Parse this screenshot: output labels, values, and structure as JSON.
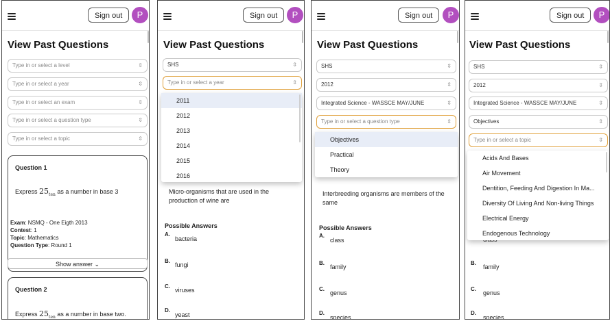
{
  "header": {
    "sign_out_label": "Sign out",
    "avatar_initial": "P"
  },
  "page_title": "View Past Questions",
  "placeholders": {
    "level": "Type in or select a level",
    "year": "Type in or select a year",
    "exam": "Type in or select an exam",
    "question_type": "Type in or select a question type",
    "topic": "Type in or select a topic"
  },
  "panel1": {
    "question1": {
      "title": "Question 1",
      "text_prefix": "Express",
      "num": "25",
      "sub": "ten",
      "text_suffix": "as a number in base 3",
      "exam_label": "Exam",
      "exam_value": ": NSMQ - One Eigth 2013",
      "contest_label": "Contest",
      "contest_value": ": 1",
      "topic_label": "Topic",
      "topic_value": ": Mathematics",
      "qtype_label": "Question Type",
      "qtype_value": ": Round 1",
      "show_answer": "Show answer",
      "chevron": "⌄"
    },
    "question2": {
      "title": "Question 2",
      "text_prefix": "Express",
      "num": "25",
      "sub": "ten",
      "text_suffix": "as a number in base two."
    }
  },
  "panel2": {
    "level_value": "SHS",
    "year_options": [
      "2011",
      "2012",
      "2013",
      "2014",
      "2015",
      "2016"
    ],
    "question_text": "Micro-organisms that are used in the production of wine are",
    "possible_answers_label": "Possible Answers",
    "answers": [
      {
        "letter": "A.",
        "text": "bacteria"
      },
      {
        "letter": "B.",
        "text": "fungi"
      },
      {
        "letter": "C.",
        "text": "viruses"
      },
      {
        "letter": "D.",
        "text": "yeast"
      }
    ]
  },
  "panel3": {
    "level_value": "SHS",
    "year_value": "2012",
    "exam_value": "Integrated Science - WASSCE MAY/JUNE",
    "qtype_options": [
      "Objectives",
      "Practical",
      "Theory"
    ],
    "question_text": "Interbreeding organisms are members of the same",
    "possible_answers_label": "Possible Answers",
    "answers": [
      {
        "letter": "A.",
        "text": "class"
      },
      {
        "letter": "B.",
        "text": "family"
      },
      {
        "letter": "C.",
        "text": "genus"
      },
      {
        "letter": "D.",
        "text": "species"
      }
    ]
  },
  "panel4": {
    "level_value": "SHS",
    "year_value": "2012",
    "exam_value": "Integrated Science - WASSCE MAY/JUNE",
    "qtype_value": "Objectives",
    "topic_options": [
      "Acids And Bases",
      "Air Movement",
      "Dentition, Feeding And Digestion In Ma...",
      "Diversity Of Living And Non-living Things",
      "Electrical Energy",
      "Endogenous Technology"
    ],
    "peek_text": "class",
    "answers": [
      {
        "letter": "B.",
        "text": "family"
      },
      {
        "letter": "C.",
        "text": "genus"
      },
      {
        "letter": "D.",
        "text": "species"
      }
    ]
  },
  "icons": {
    "updown": "⇳",
    "hamburger": "menu-icon"
  },
  "colors": {
    "avatar": "#b24fbf",
    "focus_border": "#e0a03a",
    "selected_option": "#e8edf7"
  }
}
